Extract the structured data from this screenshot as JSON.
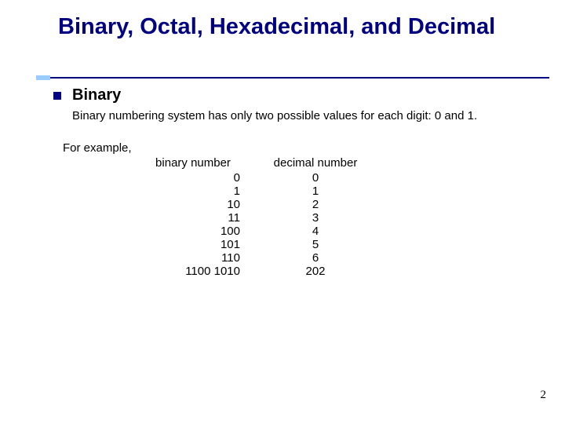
{
  "title": "Binary, Octal, Hexadecimal, and Decimal",
  "section": {
    "heading": "Binary",
    "description": "Binary numbering system has only two possible values for each digit: 0 and 1.",
    "example_lead": "For example,",
    "table": {
      "headers": {
        "binary": "binary number",
        "decimal": "decimal number"
      },
      "rows": [
        {
          "binary": "0",
          "decimal": "0"
        },
        {
          "binary": "1",
          "decimal": "1"
        },
        {
          "binary": "10",
          "decimal": "2"
        },
        {
          "binary": "11",
          "decimal": "3"
        },
        {
          "binary": "100",
          "decimal": "4"
        },
        {
          "binary": "101",
          "decimal": "5"
        },
        {
          "binary": "110",
          "decimal": "6"
        },
        {
          "binary": "1100 1010",
          "decimal": "202"
        }
      ]
    }
  },
  "page_number": "2"
}
